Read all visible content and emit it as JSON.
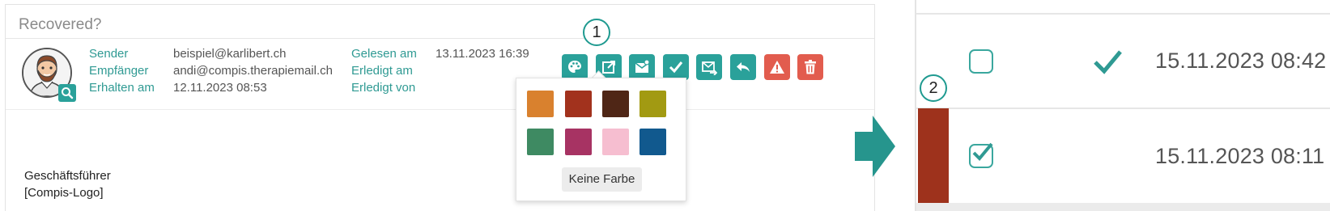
{
  "mail": {
    "subject": "Recovered?",
    "sender_label": "Sender",
    "recipient_label": "Empfänger",
    "received_label": "Erhalten am",
    "sender_value": "beispiel@karlibert.ch",
    "recipient_value": "andi@compis.therapiemail.ch",
    "received_value": "12.11.2023 08:53",
    "read_label": "Gelesen am",
    "done_label": "Erledigt am",
    "done_by_label": "Erledigt von",
    "read_value": "13.11.2023 16:39"
  },
  "actions": [
    {
      "icon": "palette-icon",
      "color": "#2aa19a"
    },
    {
      "icon": "open-external-icon",
      "color": "#2aa19a"
    },
    {
      "icon": "mark-unread-icon",
      "color": "#2aa19a"
    },
    {
      "icon": "check-icon",
      "color": "#2aa19a"
    },
    {
      "icon": "forward-mail-icon",
      "color": "#2aa19a"
    },
    {
      "icon": "reply-icon",
      "color": "#2aa19a"
    },
    {
      "icon": "warning-icon",
      "color": "#e25c4e"
    },
    {
      "icon": "trash-icon",
      "color": "#e25c4e"
    }
  ],
  "callouts": {
    "one": "1",
    "two": "2"
  },
  "color_picker": {
    "swatches": [
      "#d9812e",
      "#a2321d",
      "#4f2616",
      "#a29a12",
      "#3e8a62",
      "#a73363",
      "#f6bed0",
      "#11598e"
    ],
    "no_color_label": "Keine Farbe"
  },
  "body": {
    "line1": "Geschäftsführer",
    "line2": "[Compis-Logo]"
  },
  "list": {
    "row1_date": "15.11.2023 08:42",
    "row2_date": "15.11.2023 08:11",
    "row2_color": "#9e321c",
    "row1_checked": false,
    "row2_checked": true,
    "row1_done": true
  }
}
